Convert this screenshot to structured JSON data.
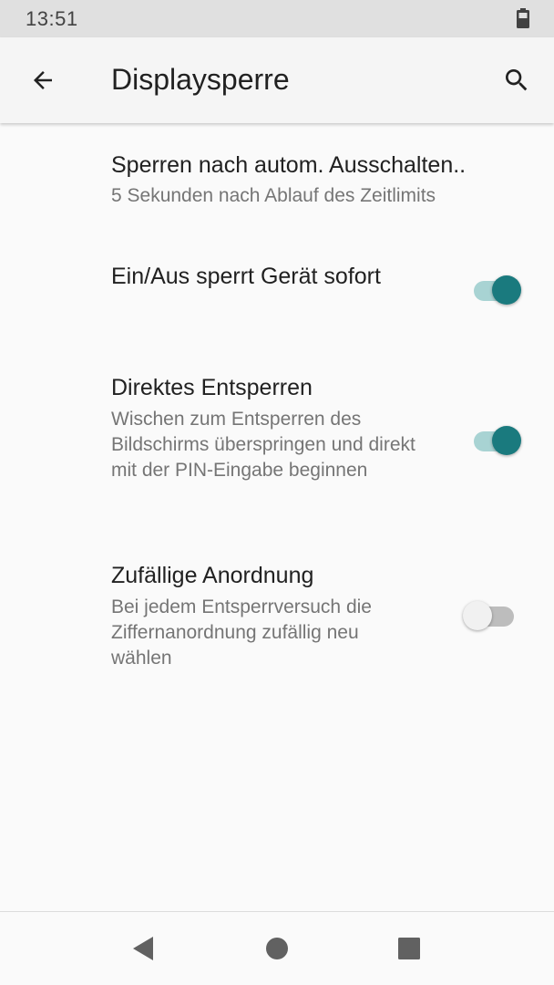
{
  "status_bar": {
    "time": "13:51",
    "battery_icon": "battery-icon"
  },
  "app_bar": {
    "title": "Displaysperre",
    "back_icon": "arrow-left-icon",
    "search_icon": "search-icon"
  },
  "preferences": [
    {
      "title": "Sperren nach autom. Ausschalten..",
      "summary": "5 Sekunden nach Ablauf des Zeitlimits"
    },
    {
      "title": "Ein/Aus sperrt Gerät sofort",
      "switch": true
    },
    {
      "title": "Direktes Entsperren",
      "summary": "Wischen zum Entsperren des Bildschirms überspringen und direkt mit der PIN-Eingabe beginnen",
      "switch": true
    },
    {
      "title": "Zufällige Anordnung",
      "summary": "Bei jedem Entsperrversuch die Ziffernanordnung zufällig neu wählen",
      "switch": false
    }
  ],
  "nav_bar": {
    "back_icon": "triangle-back-icon",
    "home_icon": "circle-home-icon",
    "recents_icon": "square-recents-icon"
  },
  "colors": {
    "accent": "#1a7a7e",
    "accent_track": "#a8d3d3",
    "status_bar_bg": "#e0e0e0",
    "app_bar_bg": "#f5f5f5",
    "background": "#fafafa"
  }
}
